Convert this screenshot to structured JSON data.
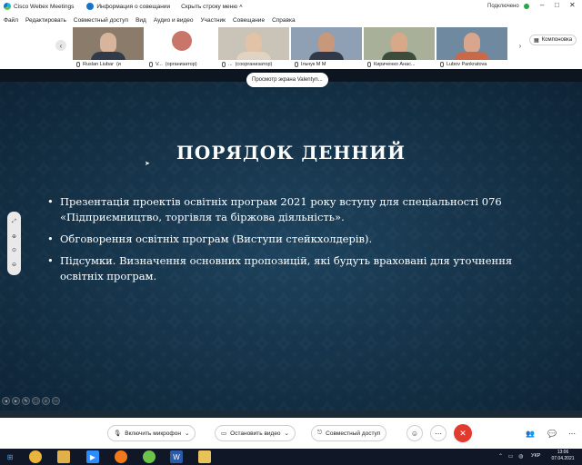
{
  "titlebar": {
    "app_title": "Cisco Webex Meetings",
    "info_tab": "Информация о совещании",
    "hide_menu": "Скрыть строку меню",
    "connection": "Подключено"
  },
  "menu": [
    "Файл",
    "Редактировать",
    "Совместный доступ",
    "Вид",
    "Аудио и видео",
    "Участник",
    "Совещание",
    "Справка"
  ],
  "participants": [
    {
      "name": "Ruslan Liubar",
      "role": "(и"
    },
    {
      "name": "V...",
      "role": "(организатор)"
    },
    {
      "name": "...",
      "role": "(соорганизатор)"
    },
    {
      "name": "Ільчук М М",
      "role": ""
    },
    {
      "name": "Кириченко Анас...",
      "role": ""
    },
    {
      "name": "Lubov Pankratova",
      "role": ""
    }
  ],
  "layout_button": "Компоновка",
  "share": {
    "presenter_tag": "Просмотр экрана Valentyn...",
    "slide_title": "ПОРЯДОК ДЕННИЙ",
    "bullets": [
      "Презентація проектів освітніх програм 2021 року вступу для спеціальності 076 «Підприємництво, торгівля та біржова діяльність».",
      "Обговорення освітніх програм (Виступи стейкхолдерів).",
      "Підсумки. Визначення основних пропозицій, які будуть враховані для уточнення освітніх програм."
    ]
  },
  "controls": {
    "mic": "Включить микрофон",
    "video": "Остановить видео",
    "share": "Совместный доступ"
  },
  "taskbar": {
    "lang": "УКР",
    "time": "13:06",
    "date": "07.04.2021"
  },
  "colors": {
    "slide_bg": "#12344a",
    "end_button": "#e23b2e",
    "active_tile": "#2aa0d8",
    "taskbar": "#101828"
  }
}
